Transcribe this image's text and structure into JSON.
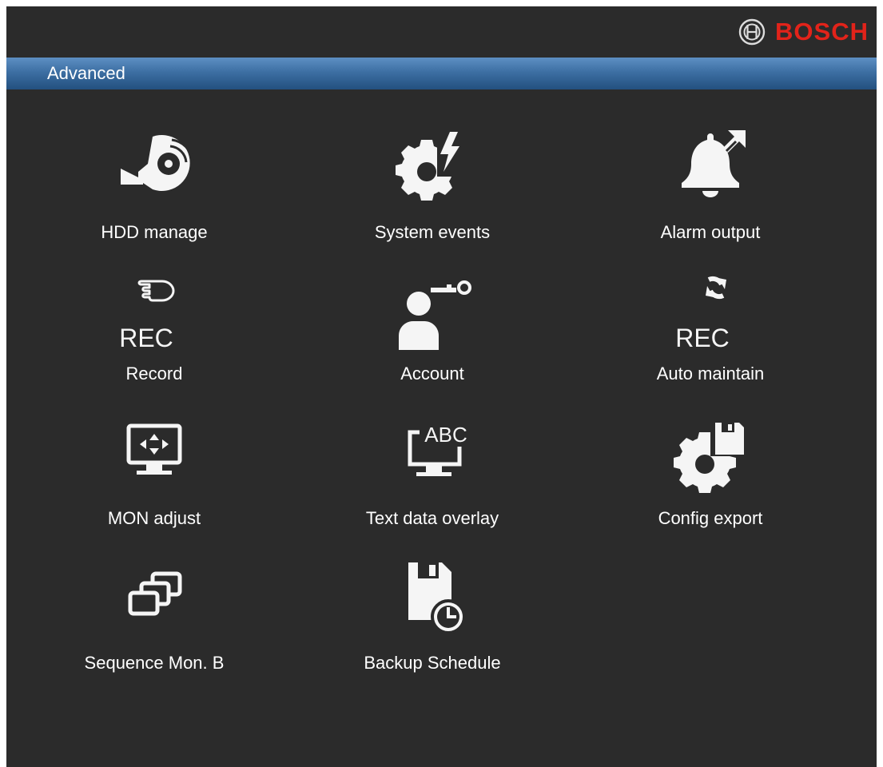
{
  "brand": {
    "logo_icon": "bosch-armature-icon",
    "name": "BOSCH",
    "color": "#e2231a"
  },
  "titlebar": {
    "title": "Advanced"
  },
  "menu": {
    "items": [
      {
        "id": "hdd",
        "label": "HDD manage",
        "icon": "hdd-disc-icon"
      },
      {
        "id": "sysevents",
        "label": "System events",
        "icon": "gear-lightning-icon"
      },
      {
        "id": "alarm",
        "label": "Alarm output",
        "icon": "bell-arrow-icon"
      },
      {
        "id": "record",
        "label": "Record",
        "icon": "hand-pointer-rec-icon",
        "icon_text": "REC"
      },
      {
        "id": "account",
        "label": "Account",
        "icon": "user-key-icon"
      },
      {
        "id": "automaintain",
        "label": "Auto maintain",
        "icon": "refresh-rec-icon",
        "icon_text": "REC"
      },
      {
        "id": "monadjust",
        "label": "MON adjust",
        "icon": "monitor-arrows-icon"
      },
      {
        "id": "textoverlay",
        "label": "Text data overlay",
        "icon": "monitor-abc-icon",
        "icon_text": "ABC"
      },
      {
        "id": "configexport",
        "label": "Config export",
        "icon": "gear-floppy-icon"
      },
      {
        "id": "sequence",
        "label": "Sequence Mon. B",
        "icon": "stacked-windows-icon"
      },
      {
        "id": "backup",
        "label": "Backup Schedule",
        "icon": "floppy-clock-icon"
      }
    ]
  }
}
